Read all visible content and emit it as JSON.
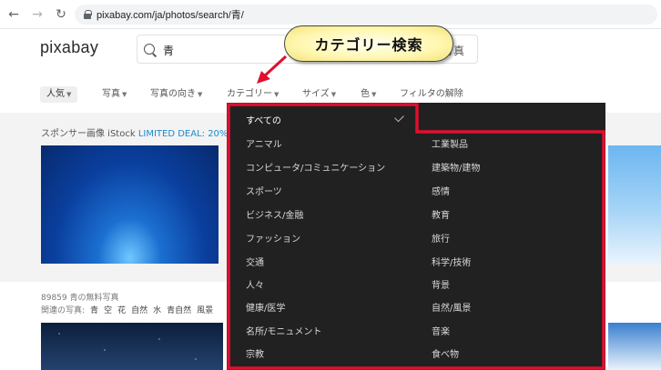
{
  "browser": {
    "back_icon": "back-arrow-icon",
    "forward_icon": "forward-arrow-icon",
    "reload_icon": "reload-icon",
    "url": "pixabay.com/ja/photos/search/青/"
  },
  "header": {
    "logo": "pixabay",
    "search_value": "青",
    "search_type": "写真"
  },
  "callout": {
    "text": "カテゴリー検索",
    "color": "#fff7b0"
  },
  "filters": {
    "items": [
      "人気",
      "写真",
      "写真の向き",
      "カテゴリー",
      "サイズ",
      "色"
    ],
    "clear": "フィルタの解除"
  },
  "sponsor": {
    "prefix": "スポンサー画像 iStock ",
    "deal": "LIMITED DEAL: 20%"
  },
  "results": {
    "count": "89859 青の無料写真",
    "related_label": "関連の写真:",
    "related_tags": [
      "青",
      "空",
      "花",
      "自然",
      "水",
      "青自然",
      "風景"
    ]
  },
  "dropdown": {
    "border_color": "#e0102f",
    "left_items": [
      "すべての",
      "アニマル",
      "コンピュータ/コミュニケーション",
      "スポーツ",
      "ビジネス/金融",
      "ファッション",
      "交通",
      "人々",
      "健康/医学",
      "名所/モニュメント",
      "宗教"
    ],
    "right_items": [
      "工業製品",
      "建築物/建物",
      "感情",
      "教育",
      "旅行",
      "科学/技術",
      "背景",
      "自然/風景",
      "音楽",
      "食べ物"
    ],
    "selected": "すべての"
  }
}
